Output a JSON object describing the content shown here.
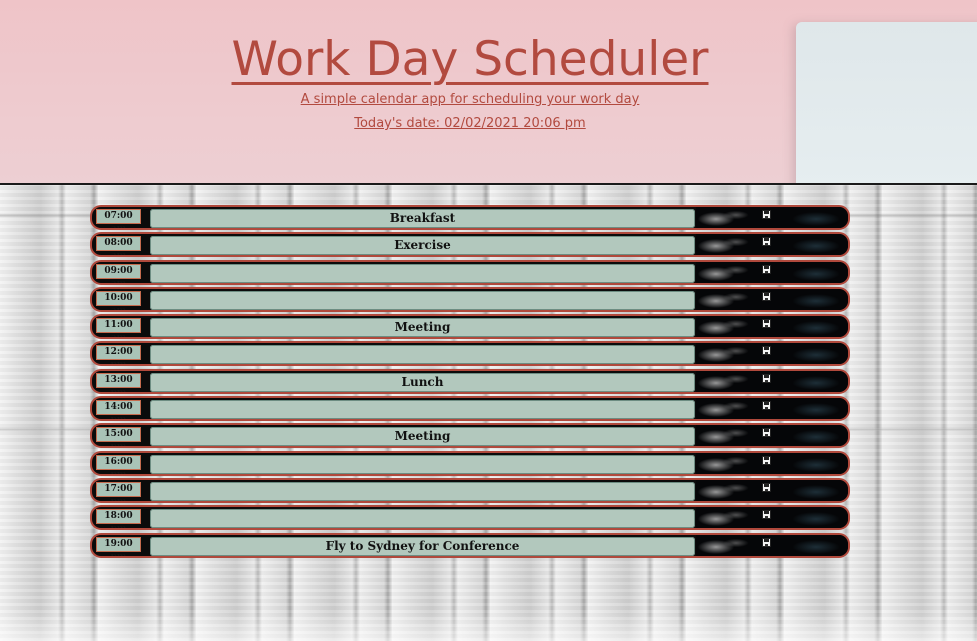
{
  "header": {
    "title": "Work Day Scheduler",
    "subtitle": "A simple calendar app for scheduling your work day",
    "today": "Today's date: 02/02/2021 20:06 pm"
  },
  "colors": {
    "accent": "#b0493c",
    "header_bg": "#efc4c8",
    "row_input": "#b2c8bd",
    "row_bg": "#0b0b0b"
  },
  "schedule": {
    "save_icon": "floppy-disk-icon",
    "rows": [
      {
        "hour": "07:00 am",
        "task": "Breakfast"
      },
      {
        "hour": "08:00 am",
        "task": "Exercise"
      },
      {
        "hour": "09:00 am",
        "task": ""
      },
      {
        "hour": "10:00 am",
        "task": ""
      },
      {
        "hour": "11:00 am",
        "task": "Meeting"
      },
      {
        "hour": "12:00 pm",
        "task": ""
      },
      {
        "hour": "13:00 pm",
        "task": "Lunch"
      },
      {
        "hour": "14:00 pm",
        "task": ""
      },
      {
        "hour": "15:00 pm",
        "task": "Meeting"
      },
      {
        "hour": "16:00 pm",
        "task": ""
      },
      {
        "hour": "17:00 pm",
        "task": ""
      },
      {
        "hour": "18:00 pm",
        "task": ""
      },
      {
        "hour": "19:00 pm",
        "task": "Fly to Sydney for Conference"
      }
    ]
  }
}
